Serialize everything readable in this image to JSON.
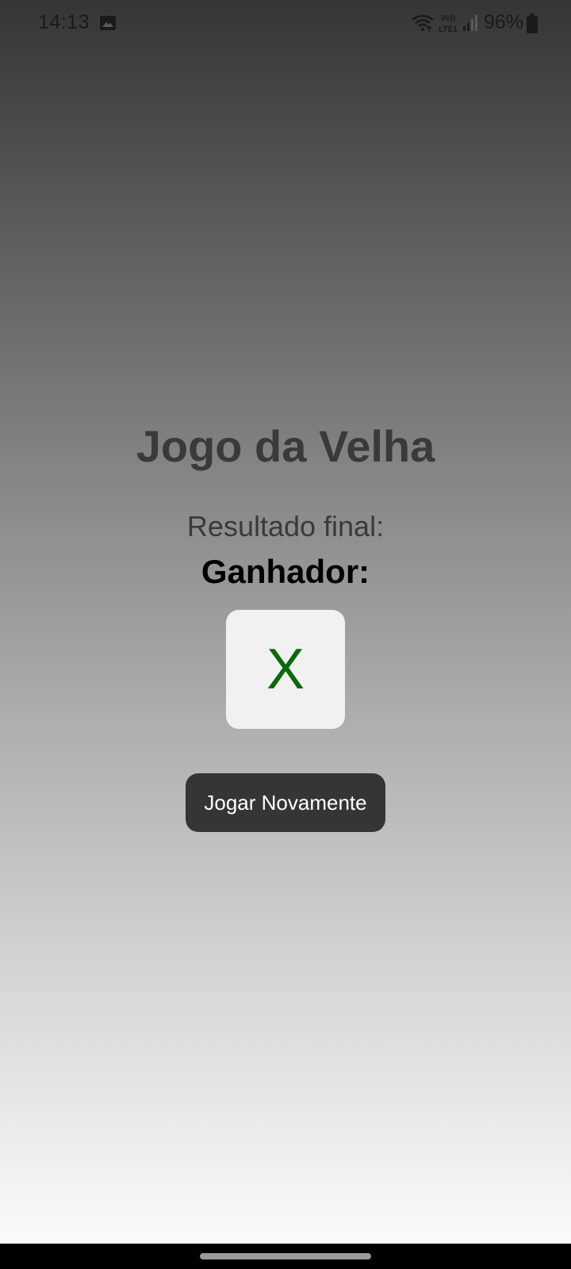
{
  "status_bar": {
    "time": "14:13",
    "battery": "96%",
    "network": "VoLTE1",
    "icons": [
      "gallery-icon",
      "wifi-icon",
      "volte-icon",
      "signal-icon",
      "battery-icon"
    ]
  },
  "game": {
    "title": "Jogo da Velha",
    "result_label": "Resultado final:",
    "winner_label": "Ganhador:",
    "winner_symbol": "X",
    "play_again_label": "Jogar Novamente"
  },
  "colors": {
    "winner_symbol": "#0a6a0a",
    "button_bg": "#353535",
    "button_text": "#ffffff"
  }
}
